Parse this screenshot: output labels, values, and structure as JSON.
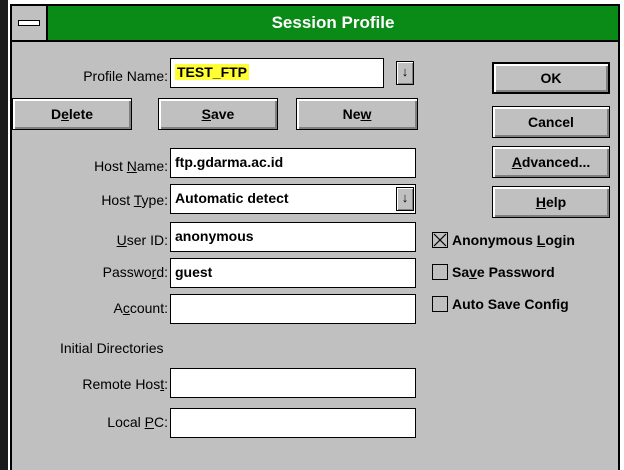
{
  "window": {
    "title": "Session Profile"
  },
  "profile": {
    "label": "Profile Name:",
    "value": "TEST_FTP"
  },
  "actions": {
    "delete": "Delete",
    "save": "Save",
    "new": "New"
  },
  "fields": {
    "host_name": {
      "label": "Host Name:",
      "value": "ftp.gdarma.ac.id"
    },
    "host_type": {
      "label": "Host Type:",
      "value": "Automatic detect"
    },
    "user_id": {
      "label": "User ID:",
      "value": "anonymous"
    },
    "password": {
      "label": "Password:",
      "value": "guest"
    },
    "account": {
      "label": "Account:",
      "value": ""
    }
  },
  "initial_dirs": {
    "heading": "Initial Directories",
    "remote_host": {
      "label": "Remote Host:",
      "value": ""
    },
    "local_pc": {
      "label": "Local PC:",
      "value": ""
    }
  },
  "side_buttons": {
    "ok": "OK",
    "cancel": "Cancel",
    "advanced": "Advanced...",
    "help": "Help"
  },
  "options": [
    {
      "label": "Anonymous Login",
      "checked": true
    },
    {
      "label": "Save Password",
      "checked": false
    },
    {
      "label": "Auto Save Config",
      "checked": false
    }
  ],
  "icons": {
    "system_menu": "system-menu-icon",
    "dropdown": "dropdown-arrow-icon"
  },
  "colors": {
    "titlebar": "#0a8a16",
    "dialog_bg": "#c0c0c0",
    "highlight": "#ffff33"
  }
}
